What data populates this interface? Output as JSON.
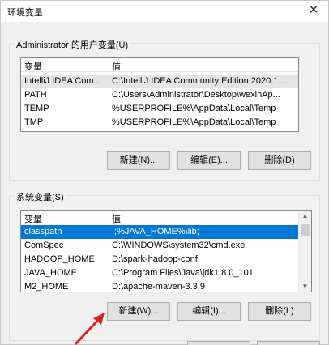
{
  "window": {
    "title": "环境变量",
    "close_glyph": "✕"
  },
  "user_vars": {
    "group_label": "Administrator 的用户变量(U)",
    "headers": [
      "变量",
      "值"
    ],
    "rows": [
      {
        "name": "IntelliJ IDEA Com...",
        "value": "C:\\IntelliJ IDEA Community Edition 2020.1...."
      },
      {
        "name": "PATH",
        "value": "C:\\Users\\Administrator\\Desktop\\wexinAp..."
      },
      {
        "name": "TEMP",
        "value": "%USERPROFILE%\\AppData\\Local\\Temp"
      },
      {
        "name": "TMP",
        "value": "%USERPROFILE%\\AppData\\Local\\Temp"
      }
    ],
    "buttons": {
      "new": "新建(N)...",
      "edit": "编辑(E)...",
      "delete": "删除(D)"
    }
  },
  "system_vars": {
    "group_label": "系统变量(S)",
    "headers": [
      "变量",
      "值"
    ],
    "rows": [
      {
        "name": "classpath",
        "value": ".;%JAVA_HOME%\\lib;"
      },
      {
        "name": "ComSpec",
        "value": "C:\\WINDOWS\\system32\\cmd.exe"
      },
      {
        "name": "HADOOP_HOME",
        "value": "D:\\spark-hadoop-conf"
      },
      {
        "name": "JAVA_HOME",
        "value": "C:\\Program Files\\Java\\jdk1.8.0_101"
      },
      {
        "name": "M2_HOME",
        "value": "D:\\apache-maven-3.3.9"
      }
    ],
    "buttons": {
      "new": "新建(W)...",
      "edit": "编辑(I)...",
      "delete": "删除(L)"
    }
  },
  "colors": {
    "selection": "#0078d7",
    "annotation_arrow": "#e02020"
  }
}
